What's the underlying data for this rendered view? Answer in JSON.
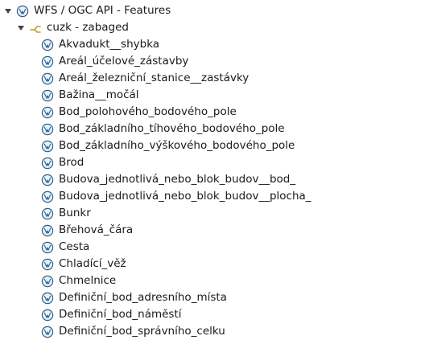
{
  "browser": {
    "root": {
      "label": "WFS / OGC API - Features",
      "icon": "wfs-icon",
      "expanded": true
    },
    "connection": {
      "label": "cuzk - zabaged",
      "icon": "connection-icon",
      "expanded": true
    },
    "layers": [
      {
        "label": "Akvadukt__shybka",
        "icon": "wfs-layer-icon"
      },
      {
        "label": "Areál_účelové_zástavby",
        "icon": "wfs-layer-icon"
      },
      {
        "label": "Areál_železniční_stanice__zastávky",
        "icon": "wfs-layer-icon"
      },
      {
        "label": "Bažina__močál",
        "icon": "wfs-layer-icon"
      },
      {
        "label": "Bod_polohového_bodového_pole",
        "icon": "wfs-layer-icon"
      },
      {
        "label": "Bod_základního_tíhového_bodového_pole",
        "icon": "wfs-layer-icon"
      },
      {
        "label": "Bod_základního_výškového_bodového_pole",
        "icon": "wfs-layer-icon"
      },
      {
        "label": "Brod",
        "icon": "wfs-layer-icon"
      },
      {
        "label": "Budova_jednotlivá_nebo_blok_budov__bod_",
        "icon": "wfs-layer-icon"
      },
      {
        "label": "Budova_jednotlivá_nebo_blok_budov__plocha_",
        "icon": "wfs-layer-icon"
      },
      {
        "label": "Bunkr",
        "icon": "wfs-layer-icon"
      },
      {
        "label": "Břehová_čára",
        "icon": "wfs-layer-icon"
      },
      {
        "label": "Cesta",
        "icon": "wfs-layer-icon"
      },
      {
        "label": "Chladící_věž",
        "icon": "wfs-layer-icon"
      },
      {
        "label": "Chmelnice",
        "icon": "wfs-layer-icon"
      },
      {
        "label": "Definiční_bod_adresního_místa",
        "icon": "wfs-layer-icon"
      },
      {
        "label": "Definiční_bod_náměstí",
        "icon": "wfs-layer-icon"
      },
      {
        "label": "Definiční_bod_správního_celku",
        "icon": "wfs-layer-icon"
      }
    ],
    "colors": {
      "icon_stroke": "#2f5e8c",
      "icon_fill": "#eaf2fb",
      "connection_icon": "#c79a2e",
      "expander": "#444444"
    }
  }
}
